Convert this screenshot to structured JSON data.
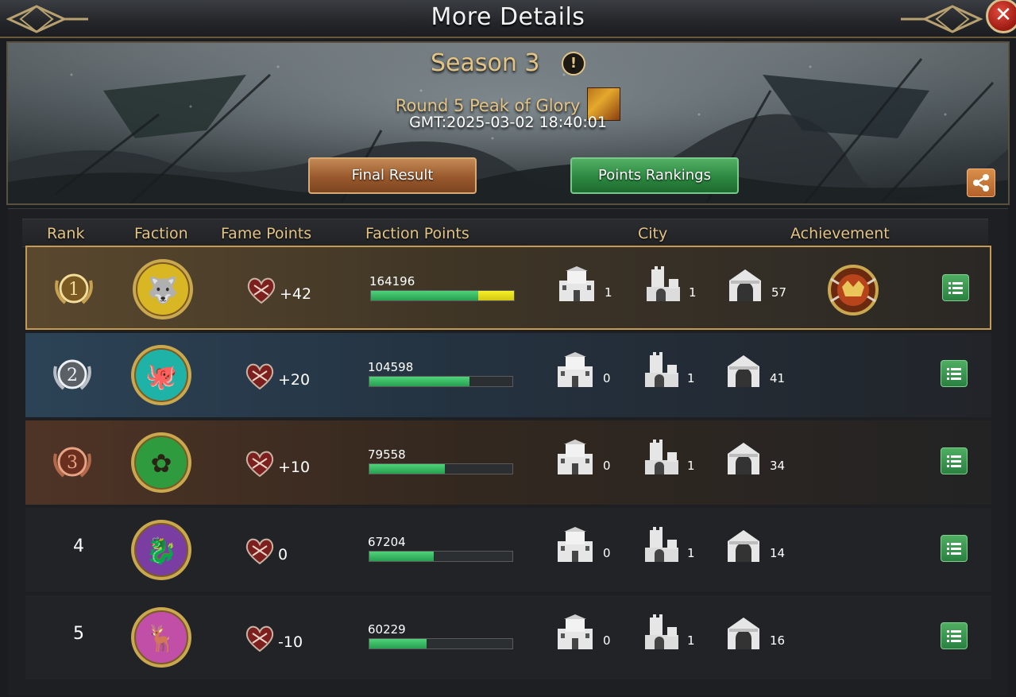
{
  "window": {
    "title": "More Details",
    "close_icon": "close-icon"
  },
  "banner": {
    "season": "Season 3",
    "info_icon": "info-icon",
    "round": "Round 5 Peak of Glory",
    "gmt": "GMT:2025-03-02 18:40:01",
    "final_result_label": "Final Result",
    "points_rankings_label": "Points Rankings",
    "share_icon": "share-icon"
  },
  "table": {
    "headers": {
      "rank": "Rank",
      "faction": "Faction",
      "fame_points": "Fame Points",
      "faction_points": "Faction Points",
      "city": "City",
      "achievement": "Achievement"
    },
    "rows": [
      {
        "rank": "1",
        "medal": "gold",
        "emblem": "wolf",
        "emblem_color": "#d9b724",
        "fame": "+42",
        "faction_points": "164196",
        "bar_green": 0.75,
        "bar_yellow": 0.25,
        "city_large": "1",
        "city_fort": "1",
        "city_gate": "57",
        "achievement": "achievement-emblem"
      },
      {
        "rank": "2",
        "medal": "silver",
        "emblem": "kraken",
        "emblem_color": "#1fb3a8",
        "fame": "+20",
        "faction_points": "104598",
        "bar_green": 0.7,
        "bar_yellow": 0,
        "city_large": "0",
        "city_fort": "1",
        "city_gate": "41",
        "achievement": ""
      },
      {
        "rank": "3",
        "medal": "bronze",
        "emblem": "rose",
        "emblem_color": "#2e9b3e",
        "fame": "+10",
        "faction_points": "79558",
        "bar_green": 0.53,
        "bar_yellow": 0,
        "city_large": "0",
        "city_fort": "1",
        "city_gate": "34",
        "achievement": ""
      },
      {
        "rank": "4",
        "medal": "",
        "emblem": "dragon",
        "emblem_color": "#7a3ea3",
        "fame": "0",
        "faction_points": "67204",
        "bar_green": 0.45,
        "bar_yellow": 0,
        "city_large": "0",
        "city_fort": "1",
        "city_gate": "14",
        "achievement": ""
      },
      {
        "rank": "5",
        "medal": "",
        "emblem": "stag",
        "emblem_color": "#c14fa8",
        "fame": "-10",
        "faction_points": "60229",
        "bar_green": 0.4,
        "bar_yellow": 0,
        "city_large": "0",
        "city_fort": "1",
        "city_gate": "16",
        "achievement": ""
      }
    ]
  }
}
